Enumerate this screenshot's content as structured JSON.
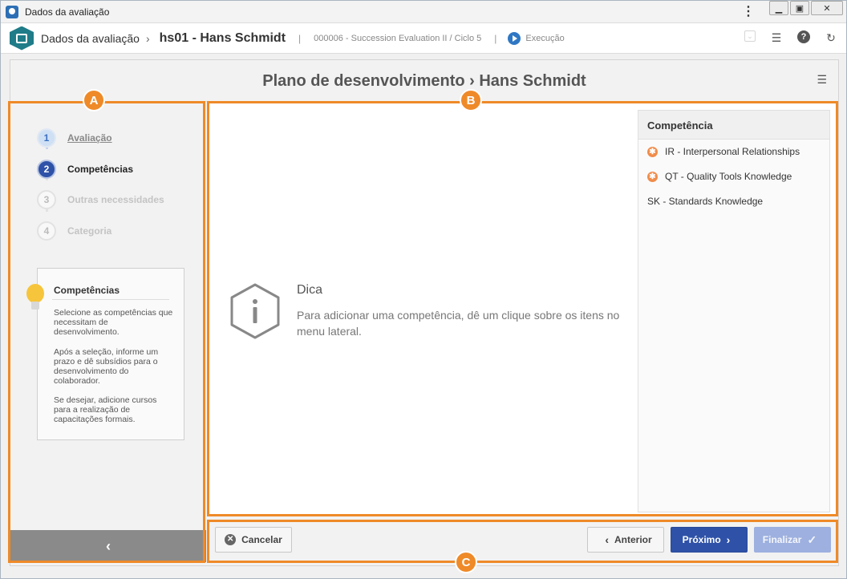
{
  "window": {
    "title": "Dados da avaliação"
  },
  "header": {
    "crumb_root": "Dados da avaliação",
    "crumb_current": "hs01 - Hans Schmidt",
    "separator": "|",
    "evaluation_meta": "000006 - Succession Evaluation II / Ciclo 5",
    "status_label": "Execução"
  },
  "page": {
    "title": "Plano de desenvolvimento › Hans Schmidt"
  },
  "wizard": {
    "steps": [
      {
        "num": "1",
        "label": "Avaliação",
        "state": "done"
      },
      {
        "num": "2",
        "label": "Competências",
        "state": "active"
      },
      {
        "num": "3",
        "label": "Outras necessidades",
        "state": "disabled"
      },
      {
        "num": "4",
        "label": "Categoria",
        "state": "disabled"
      }
    ]
  },
  "tip": {
    "title": "Competências",
    "p1": "Selecione as competências que necessitam de desenvolvimento.",
    "p2": "Após a seleção, informe um prazo e dê subsídios para o desenvolvimento do colaborador.",
    "p3": "Se desejar, adicione cursos para a realização de capacitações formais."
  },
  "hint": {
    "title": "Dica",
    "text": "Para adicionar uma competência, dê um clique sobre os itens no menu lateral."
  },
  "competencies": {
    "header": "Competência",
    "items": [
      {
        "label": "IR - Interpersonal Relationships",
        "required": true
      },
      {
        "label": "QT - Quality Tools Knowledge",
        "required": true
      },
      {
        "label": "SK - Standards Knowledge",
        "required": false
      }
    ]
  },
  "footer": {
    "cancel": "Cancelar",
    "previous": "Anterior",
    "next": "Próximo",
    "finish": "Finalizar"
  },
  "callouts": {
    "a": "A",
    "b": "B",
    "c": "C"
  },
  "colors": {
    "primary": "#2f52a8",
    "callout": "#ef8a28",
    "teal": "#1f7c88",
    "badge": "#f08c4a"
  }
}
